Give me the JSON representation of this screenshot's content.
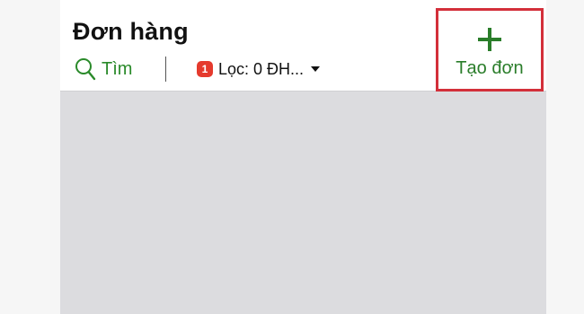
{
  "header": {
    "title": "Đơn hàng",
    "search_label": "Tìm",
    "filter": {
      "badge": "1",
      "label": "Lọc: 0 ĐH..."
    },
    "create_label": "Tạo đơn"
  },
  "colors": {
    "accent_green": "#2a7d2a",
    "badge_red": "#e53a2d",
    "highlight_red": "#d32f3a",
    "content_gray": "#dcdcdf"
  },
  "icons": {
    "search": "search-icon",
    "create": "plus-icon",
    "filter_dropdown": "chevron-down-icon"
  }
}
